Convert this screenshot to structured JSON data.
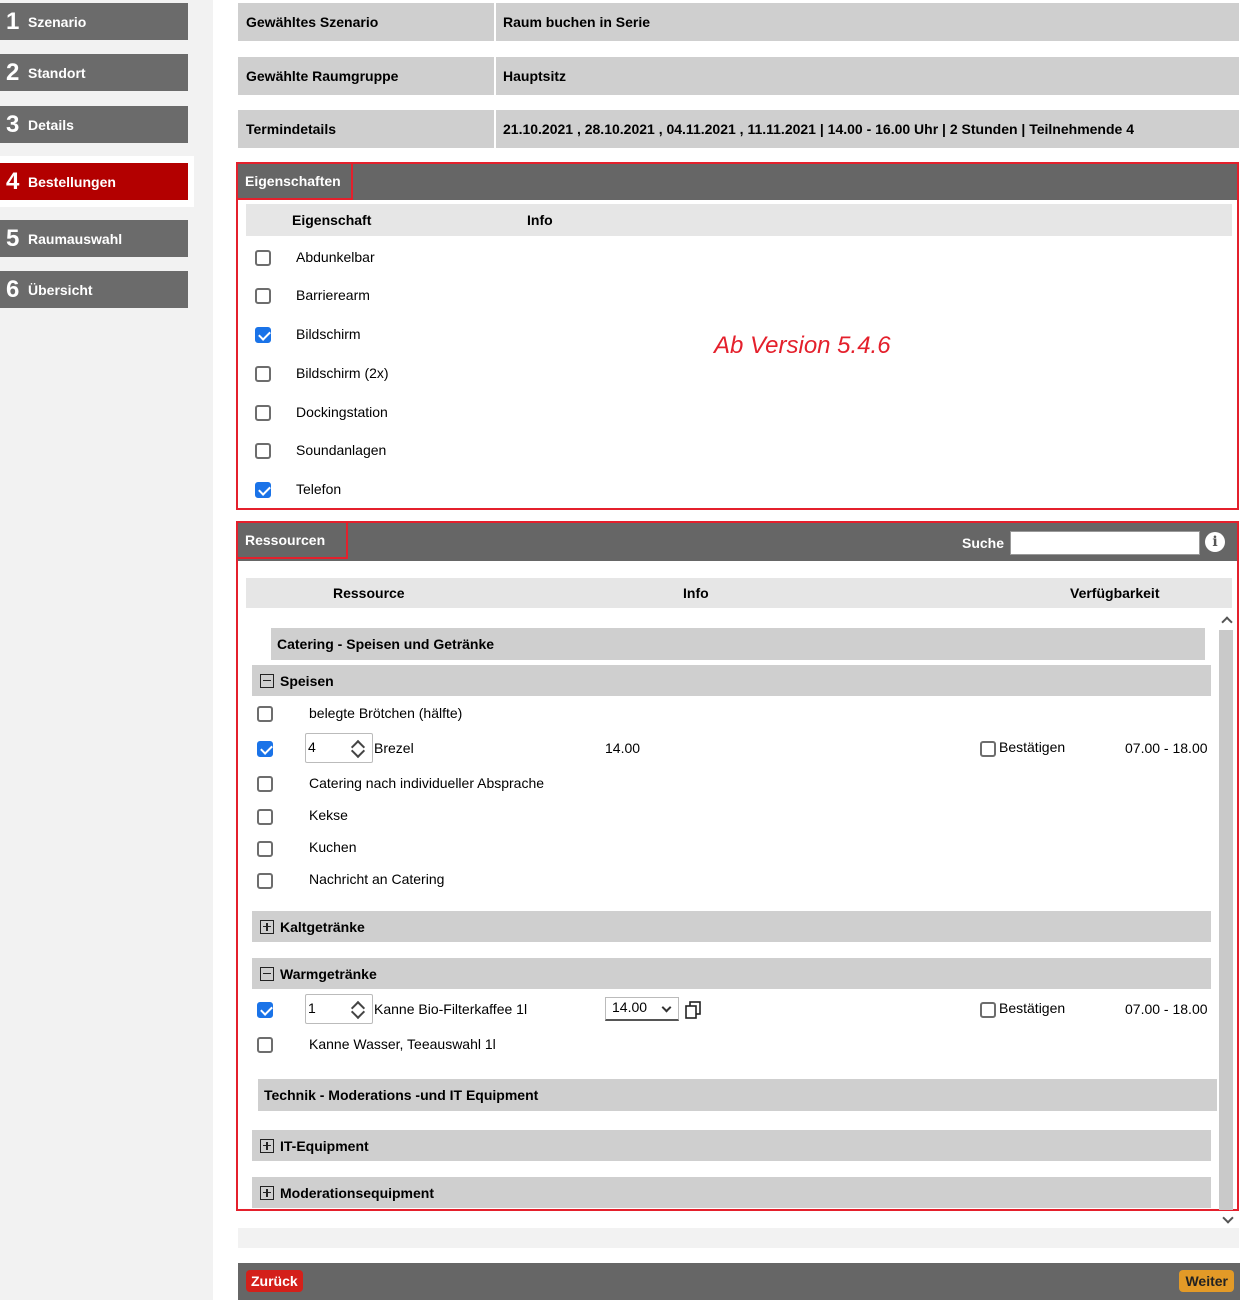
{
  "sidebar": {
    "steps": [
      {
        "num": "1",
        "label": "Szenario"
      },
      {
        "num": "2",
        "label": "Standort"
      },
      {
        "num": "3",
        "label": "Details"
      },
      {
        "num": "4",
        "label": "Bestellungen"
      },
      {
        "num": "5",
        "label": "Raumauswahl"
      },
      {
        "num": "6",
        "label": "Übersicht"
      }
    ]
  },
  "summary": {
    "scenario_label": "Gewähltes Szenario",
    "scenario_value": "Raum buchen in Serie",
    "roomgroup_label": "Gewählte Raumgruppe",
    "roomgroup_value": "Hauptsitz",
    "details_label": "Termindetails",
    "details_value": "21.10.2021 , 28.10.2021 , 04.11.2021 , 11.11.2021 | 14.00 - 16.00 Uhr | 2 Stunden | Teilnehmende 4"
  },
  "properties": {
    "title": "Eigenschaften",
    "col_property": "Eigenschaft",
    "col_info": "Info",
    "items": [
      {
        "label": "Abdunkelbar",
        "checked": false
      },
      {
        "label": "Barrierearm",
        "checked": false
      },
      {
        "label": "Bildschirm",
        "checked": true
      },
      {
        "label": "Bildschirm (2x)",
        "checked": false
      },
      {
        "label": "Dockingstation",
        "checked": false
      },
      {
        "label": "Soundanlagen",
        "checked": false
      },
      {
        "label": "Telefon",
        "checked": true
      }
    ],
    "annotation": "Ab Version 5.4.6"
  },
  "resources": {
    "title": "Ressourcen",
    "search_label": "Suche",
    "search_value": "",
    "col_resource": "Ressource",
    "col_info": "Info",
    "col_availability": "Verfügbarkeit",
    "catering_group": "Catering - Speisen und Getränke",
    "speisen": "Speisen",
    "speisen_items": [
      {
        "label": "belegte Brötchen (hälfte)",
        "checked": false
      },
      {
        "label": "Brezel",
        "checked": true,
        "qty": "4",
        "info": "14.00",
        "confirm": "Bestätigen",
        "availability": "07.00 - 18.00"
      },
      {
        "label": "Catering nach individueller Absprache",
        "checked": false
      },
      {
        "label": "Kekse",
        "checked": false
      },
      {
        "label": "Kuchen",
        "checked": false
      },
      {
        "label": "Nachricht an Catering",
        "checked": false
      }
    ],
    "kaltgetraenke": "Kaltgetränke",
    "warmgetraenke": "Warmgetränke",
    "warm_items": [
      {
        "label": "Kanne Bio-Filterkaffee 1l",
        "checked": true,
        "qty": "1",
        "time": "14.00",
        "confirm": "Bestätigen",
        "availability": "07.00 - 18.00"
      },
      {
        "label": "Kanne Wasser, Teeauswahl 1l",
        "checked": false
      }
    ],
    "technik_group": "Technik - Moderations -und IT Equipment",
    "it_equipment": "IT-Equipment",
    "moderation": "Moderationsequipment"
  },
  "footer": {
    "back": "Zurück",
    "next": "Weiter"
  }
}
